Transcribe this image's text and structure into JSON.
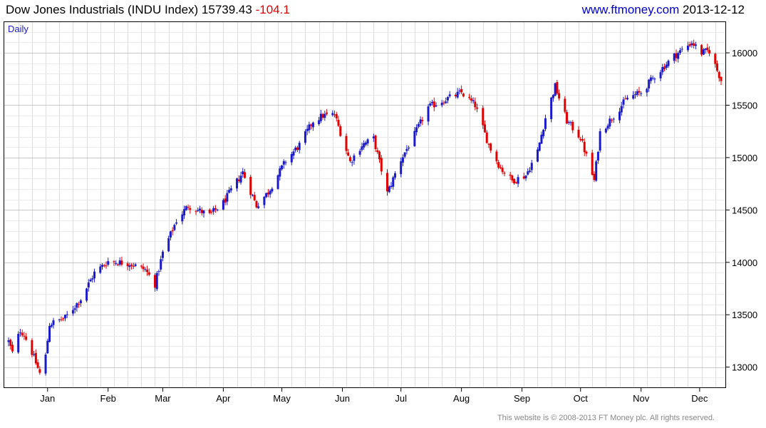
{
  "header": {
    "title": "Dow Jones Industrials (INDU Index) 15739.43",
    "change": "-104.1",
    "site": "www.ftmoney.com",
    "date": "2013-12-12"
  },
  "footer": "This website is © 2008-2013 FT Money plc. All rights reserved.",
  "colors": {
    "up": "#1a1acc",
    "down": "#e00000",
    "grid": "#dcdcdc",
    "frame": "#000000",
    "period_label": "#1a1acc"
  },
  "chart_data": {
    "type": "candlestick",
    "period_label": "Daily",
    "ylim": [
      12800,
      16300
    ],
    "y_ticks": [
      13000,
      13500,
      14000,
      14500,
      15000,
      15500,
      16000
    ],
    "x_labels": [
      "Jan",
      "Feb",
      "Mar",
      "Apr",
      "May",
      "Jun",
      "Jul",
      "Aug",
      "Sep",
      "Oct",
      "Nov",
      "Dec"
    ],
    "x_range": [
      "2012-12-12",
      "2013-12-12"
    ],
    "grid": true,
    "closing_path": [
      [
        "2012-12-12",
        13245
      ],
      [
        "2012-12-14",
        13135
      ],
      [
        "2012-12-18",
        13350
      ],
      [
        "2012-12-20",
        13310
      ],
      [
        "2012-12-24",
        13140
      ],
      [
        "2012-12-28",
        12940
      ],
      [
        "2012-12-31",
        13105
      ],
      [
        "2013-01-02",
        13410
      ],
      [
        "2013-01-10",
        13470
      ],
      [
        "2013-01-18",
        13650
      ],
      [
        "2013-01-25",
        13900
      ],
      [
        "2013-02-01",
        14010
      ],
      [
        "2013-02-12",
        13990
      ],
      [
        "2013-02-20",
        13930
      ],
      [
        "2013-02-25",
        13790
      ],
      [
        "2013-03-01",
        14090
      ],
      [
        "2013-03-08",
        14400
      ],
      [
        "2013-03-14",
        14540
      ],
      [
        "2013-03-25",
        14450
      ],
      [
        "2013-04-01",
        14570
      ],
      [
        "2013-04-11",
        14860
      ],
      [
        "2013-04-18",
        14540
      ],
      [
        "2013-04-24",
        14670
      ],
      [
        "2013-05-03",
        14970
      ],
      [
        "2013-05-10",
        15120
      ],
      [
        "2013-05-17",
        15350
      ],
      [
        "2013-05-22",
        15400
      ],
      [
        "2013-05-28",
        15410
      ],
      [
        "2013-06-05",
        14960
      ],
      [
        "2013-06-11",
        15120
      ],
      [
        "2013-06-17",
        15180
      ],
      [
        "2013-06-24",
        14660
      ],
      [
        "2013-07-01",
        14980
      ],
      [
        "2013-07-08",
        15220
      ],
      [
        "2013-07-15",
        15480
      ],
      [
        "2013-07-22",
        15540
      ],
      [
        "2013-08-01",
        15620
      ],
      [
        "2013-08-08",
        15500
      ],
      [
        "2013-08-15",
        15120
      ],
      [
        "2013-08-21",
        14900
      ],
      [
        "2013-08-27",
        14780
      ],
      [
        "2013-09-03",
        14830
      ],
      [
        "2013-09-09",
        15060
      ],
      [
        "2013-09-13",
        15380
      ],
      [
        "2013-09-18",
        15680
      ],
      [
        "2013-09-24",
        15350
      ],
      [
        "2013-10-01",
        15190
      ],
      [
        "2013-10-08",
        14780
      ],
      [
        "2013-10-11",
        15240
      ],
      [
        "2013-10-18",
        15400
      ],
      [
        "2013-10-25",
        15570
      ],
      [
        "2013-11-01",
        15620
      ],
      [
        "2013-11-08",
        15780
      ],
      [
        "2013-11-18",
        15970
      ],
      [
        "2013-11-27",
        16100
      ],
      [
        "2013-12-02",
        16000
      ],
      [
        "2013-12-06",
        16020
      ],
      [
        "2013-12-12",
        15739
      ]
    ]
  }
}
